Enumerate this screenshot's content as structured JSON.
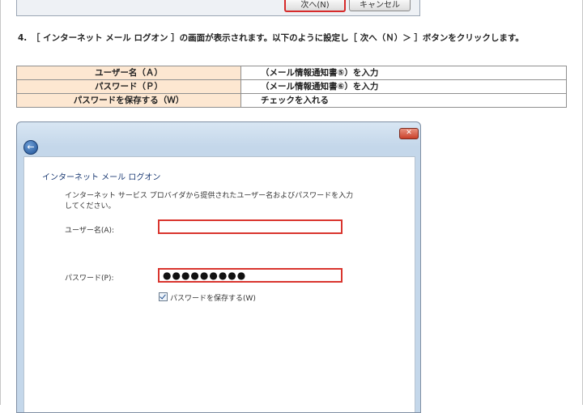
{
  "top_dialog": {
    "next_label": "次へ(N)",
    "cancel_label": "キャンセル"
  },
  "instruction": {
    "number": "4.",
    "text": "［ インターネット メール ログオン ］の画面が表示されます。以下のように設定し［ 次へ（Ｎ）＞ ］ボタンをクリックします。"
  },
  "settings_table": {
    "rows": [
      {
        "key": "ユーザー名（Ａ）",
        "value": "（メール情報通知書⑤）を入力"
      },
      {
        "key": "パスワード（Ｐ）",
        "value": "（メール情報通知書⑥）を入力"
      },
      {
        "key": "パスワードを保存する（Ｗ）",
        "value": "チェックを入れる"
      }
    ]
  },
  "wizard": {
    "close_label": "✕",
    "back_icon": "←",
    "title": "インターネット メール ログオン",
    "description": "インターネット サービス プロバイダから提供されたユーザー名およびパスワードを入力してください。",
    "username_label": "ユーザー名(A):",
    "username_value": "",
    "password_label": "パスワード(P):",
    "password_value": "●●●●●●●●●",
    "remember_label": "パスワードを保存する(W)",
    "remember_checked": true
  },
  "colors": {
    "table_key_bg": "#fde7d1",
    "highlight_red": "#d9352e",
    "title_blue": "#1b3a73"
  }
}
